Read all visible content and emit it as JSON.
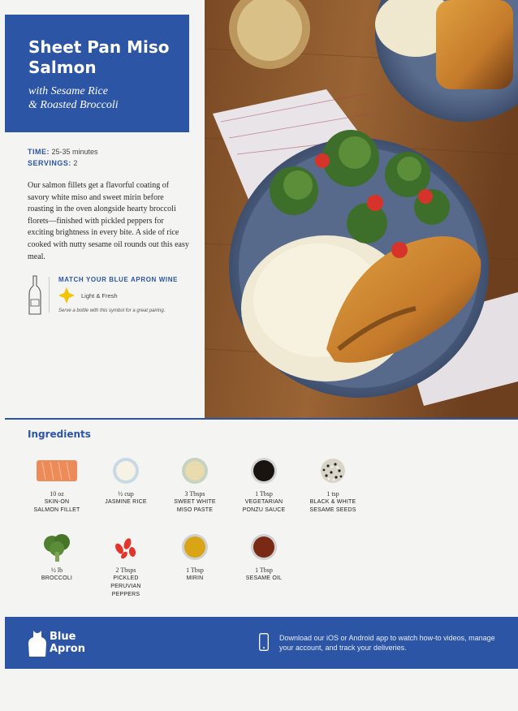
{
  "recipe": {
    "title": "Sheet Pan Miso Salmon",
    "subtitle_line1": "with Sesame Rice",
    "subtitle_line2": "& Roasted Broccoli"
  },
  "meta": {
    "time_label": "TIME:",
    "time_value": "25-35 minutes",
    "servings_label": "SERVINGS:",
    "servings_value": "2"
  },
  "description": "Our salmon fillets get a flavorful coating of savory white miso and sweet mirin before roasting in the oven alongside hearty broccoli florets—finished with pickled peppers for exciting brightness in every bite. A side of rice cooked with nutty sesame oil rounds out this easy meal.",
  "wine": {
    "title": "MATCH YOUR BLUE APRON WINE",
    "label": "Light & Fresh",
    "note": "Serve a bottle with this symbol for a great pairing.",
    "star_color": "#f4c400",
    "bottle_icon": "wine-bottle-icon"
  },
  "ingredients": {
    "title": "Ingredients",
    "items": [
      {
        "qty": "10 oz",
        "name1": "SKIN-ON",
        "name2": "SALMON FILLET",
        "name3": "",
        "icon": "salmon-fillet-icon"
      },
      {
        "qty": "½ cup",
        "name1": "JASMINE RICE",
        "name2": "",
        "name3": "",
        "icon": "rice-bowl-icon"
      },
      {
        "qty": "3 Tbsps",
        "name1": "SWEET WHITE",
        "name2": "MISO PASTE",
        "name3": "",
        "icon": "miso-bowl-icon"
      },
      {
        "qty": "1 Tbsp",
        "name1": "VEGETARIAN",
        "name2": "PONZU SAUCE",
        "name3": "",
        "icon": "ponzu-bowl-icon"
      },
      {
        "qty": "1 tsp",
        "name1": "BLACK & WHITE",
        "name2": "SESAME SEEDS",
        "name3": "",
        "icon": "sesame-seeds-icon"
      },
      {
        "qty": "½ lb",
        "name1": "BROCCOLI",
        "name2": "",
        "name3": "",
        "icon": "broccoli-icon"
      },
      {
        "qty": "2 Tbsps",
        "name1": "PICKLED",
        "name2": "PERUVIAN",
        "name3": "PEPPERS",
        "icon": "peppers-icon"
      },
      {
        "qty": "1 Tbsp",
        "name1": "MIRIN",
        "name2": "",
        "name3": "",
        "icon": "mirin-bowl-icon"
      },
      {
        "qty": "1 Tbsp",
        "name1": "SESAME OIL",
        "name2": "",
        "name3": "",
        "icon": "sesame-oil-bowl-icon"
      }
    ]
  },
  "footer": {
    "brand_line1": "Blue",
    "brand_line2": "Apron",
    "message": "Download our iOS or Android app to watch how-to videos, manage your account, and track your deliveries."
  },
  "colors": {
    "brand_blue": "#2c55a6",
    "page": "#f4f4f2"
  }
}
